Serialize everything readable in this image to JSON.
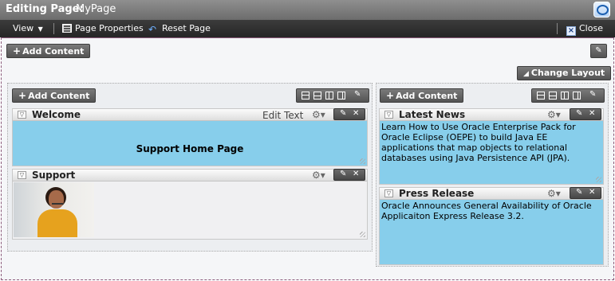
{
  "header": {
    "label": "Editing Page:",
    "page_name": "MyPage",
    "logo_icon": "oracle-webcenter-logo"
  },
  "toolbar": {
    "view_label": "View",
    "page_properties_label": "Page Properties",
    "reset_page_label": "Reset Page",
    "close_label": "Close"
  },
  "page": {
    "add_content_label": "Add Content",
    "change_layout_label": "Change Layout"
  },
  "left_column": {
    "add_content_label": "Add Content",
    "portlets": [
      {
        "title": "Welcome",
        "action_label": "Edit Text",
        "content": "Support Home Page"
      },
      {
        "title": "Support",
        "image": "support-agent-photo"
      }
    ]
  },
  "right_column": {
    "add_content_label": "Add Content",
    "portlets": [
      {
        "title": "Latest News",
        "content": "Learn How to Use Oracle Enterprise Pack for Oracle Eclipse (OEPE) to build Java EE applications that map objects to relational databases using Java Persistence API (JPA)."
      },
      {
        "title": "Press Release",
        "content": "Oracle Announces General Availability of Oracle Applicaiton Express Release 3.2."
      }
    ]
  },
  "colors": {
    "content_blue": "#87ceeb",
    "toolbar_dark": "#2f2f2f",
    "titlebar_gray": "#7d7d7d"
  }
}
